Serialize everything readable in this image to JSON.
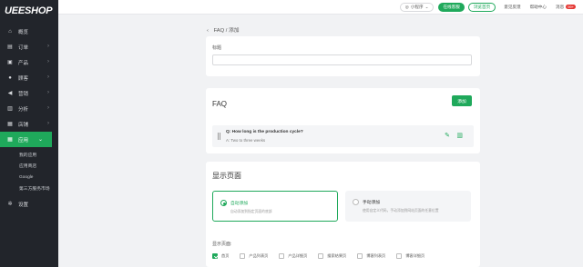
{
  "brand": {
    "logo": "UEESHOP",
    "accent": "#1fa95b",
    "sidebar_bg": "#22252b"
  },
  "sidebar": {
    "items": [
      {
        "label": "概览",
        "icon": "home-icon",
        "has_chevron": false,
        "active": false
      },
      {
        "label": "订单",
        "icon": "document-icon",
        "has_chevron": true,
        "active": false
      },
      {
        "label": "产品",
        "icon": "box-icon",
        "has_chevron": true,
        "active": false
      },
      {
        "label": "顾客",
        "icon": "users-icon",
        "has_chevron": true,
        "active": false
      },
      {
        "label": "营销",
        "icon": "megaphone-icon",
        "has_chevron": true,
        "active": false
      },
      {
        "label": "分析",
        "icon": "bar-chart-icon",
        "has_chevron": true,
        "active": false
      },
      {
        "label": "店铺",
        "icon": "store-icon",
        "has_chevron": true,
        "active": false
      },
      {
        "label": "应用",
        "icon": "apps-grid-icon",
        "has_chevron": true,
        "active": true
      }
    ],
    "sub_items": [
      "我的应用",
      "应用商店",
      "Google",
      "第三方服务市场"
    ],
    "settings": {
      "label": "设置",
      "icon": "gear-icon"
    }
  },
  "topbar": {
    "mini_program": "小程序",
    "online_service": "在线客服",
    "view_home": "浏览首页",
    "feedback": "意见反馈",
    "help": "帮助中心",
    "messages": "消息",
    "messages_badge": "99+"
  },
  "breadcrumb": {
    "text": "FAQ / 添加"
  },
  "title_card": {
    "label": "标题",
    "value": ""
  },
  "faq_card": {
    "heading": "FAQ",
    "add_label": "添加",
    "items": [
      {
        "question": "Q: How long is the production cycle?",
        "answer": "A: Two to three weeks"
      }
    ]
  },
  "display_card": {
    "heading": "显示页面",
    "options": [
      {
        "title": "自动添加",
        "desc": "自动添加到指定页面的底部",
        "selected": true
      },
      {
        "title": "手动添加",
        "desc": "使用自定义代码，手动添加到网站页面的任意位置",
        "selected": false
      }
    ],
    "pages_label": "显示页面:",
    "pages": [
      {
        "label": "首页",
        "checked": true
      },
      {
        "label": "产品列表页",
        "checked": false
      },
      {
        "label": "产品详细页",
        "checked": false
      },
      {
        "label": "搜索结果页",
        "checked": false
      },
      {
        "label": "博客列表页",
        "checked": false
      },
      {
        "label": "博客详细页",
        "checked": false
      }
    ]
  }
}
